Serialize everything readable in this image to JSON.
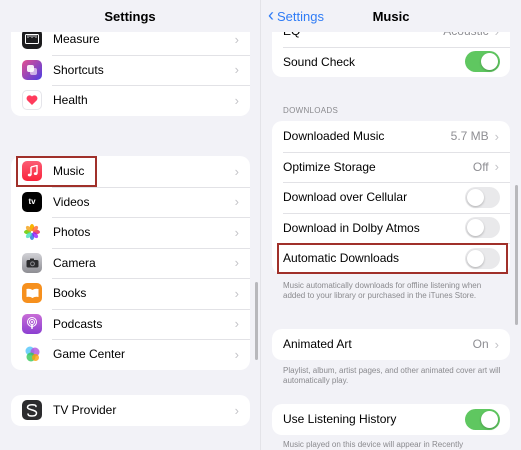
{
  "left": {
    "title": "Settings",
    "group1": [
      {
        "label": "Measure",
        "icon": "measure-icon",
        "color": "#1c1c1e"
      },
      {
        "label": "Shortcuts",
        "icon": "shortcuts-icon",
        "color": "#4b3fe3"
      },
      {
        "label": "Health",
        "icon": "health-icon",
        "color": "#ffffff"
      }
    ],
    "group2": [
      {
        "label": "Music",
        "icon": "music-icon",
        "color": "#fa2d48",
        "highlighted": true
      },
      {
        "label": "Videos",
        "icon": "tv-icon",
        "color": "#000000",
        "glyph": "tv"
      },
      {
        "label": "Photos",
        "icon": "photos-icon",
        "color": "#ffffff"
      },
      {
        "label": "Camera",
        "icon": "camera-icon",
        "color": "#8e8e93"
      },
      {
        "label": "Books",
        "icon": "books-icon",
        "color": "#f6901e"
      },
      {
        "label": "Podcasts",
        "icon": "podcasts-icon",
        "color": "#9b4fd9"
      },
      {
        "label": "Game Center",
        "icon": "game-center-icon",
        "color": "#ffffff"
      }
    ],
    "group3": [
      {
        "label": "TV Provider",
        "icon": "tv-provider-icon",
        "color": "#2c2c2e"
      }
    ]
  },
  "right": {
    "back_label": "Settings",
    "title": "Music",
    "top": {
      "eq_label": "EQ",
      "eq_value": "Acoustic",
      "sound_check_label": "Sound Check",
      "sound_check_on": true
    },
    "downloads_header": "DOWNLOADS",
    "downloads": [
      {
        "label": "Downloaded Music",
        "value": "5.7 MB",
        "type": "nav"
      },
      {
        "label": "Optimize Storage",
        "value": "Off",
        "type": "nav"
      },
      {
        "label": "Download over Cellular",
        "type": "toggle",
        "on": false
      },
      {
        "label": "Download in Dolby Atmos",
        "type": "toggle",
        "on": false
      },
      {
        "label": "Automatic Downloads",
        "type": "toggle",
        "on": false,
        "highlighted": true
      }
    ],
    "downloads_footnote": "Music automatically downloads for offline listening when added to your library or purchased in the iTunes Store.",
    "animated_art_label": "Animated Art",
    "animated_art_value": "On",
    "animated_art_footnote": "Playlist, album, artist pages, and other animated cover art will automatically play.",
    "listening_history_label": "Use Listening History",
    "listening_history_on": true,
    "listening_history_footnote": "Music played on this device will appear in Recently"
  },
  "colors": {
    "accent": "#2f7cf6",
    "toggle_on": "#5fc760",
    "highlight_border": "#a0302a"
  }
}
